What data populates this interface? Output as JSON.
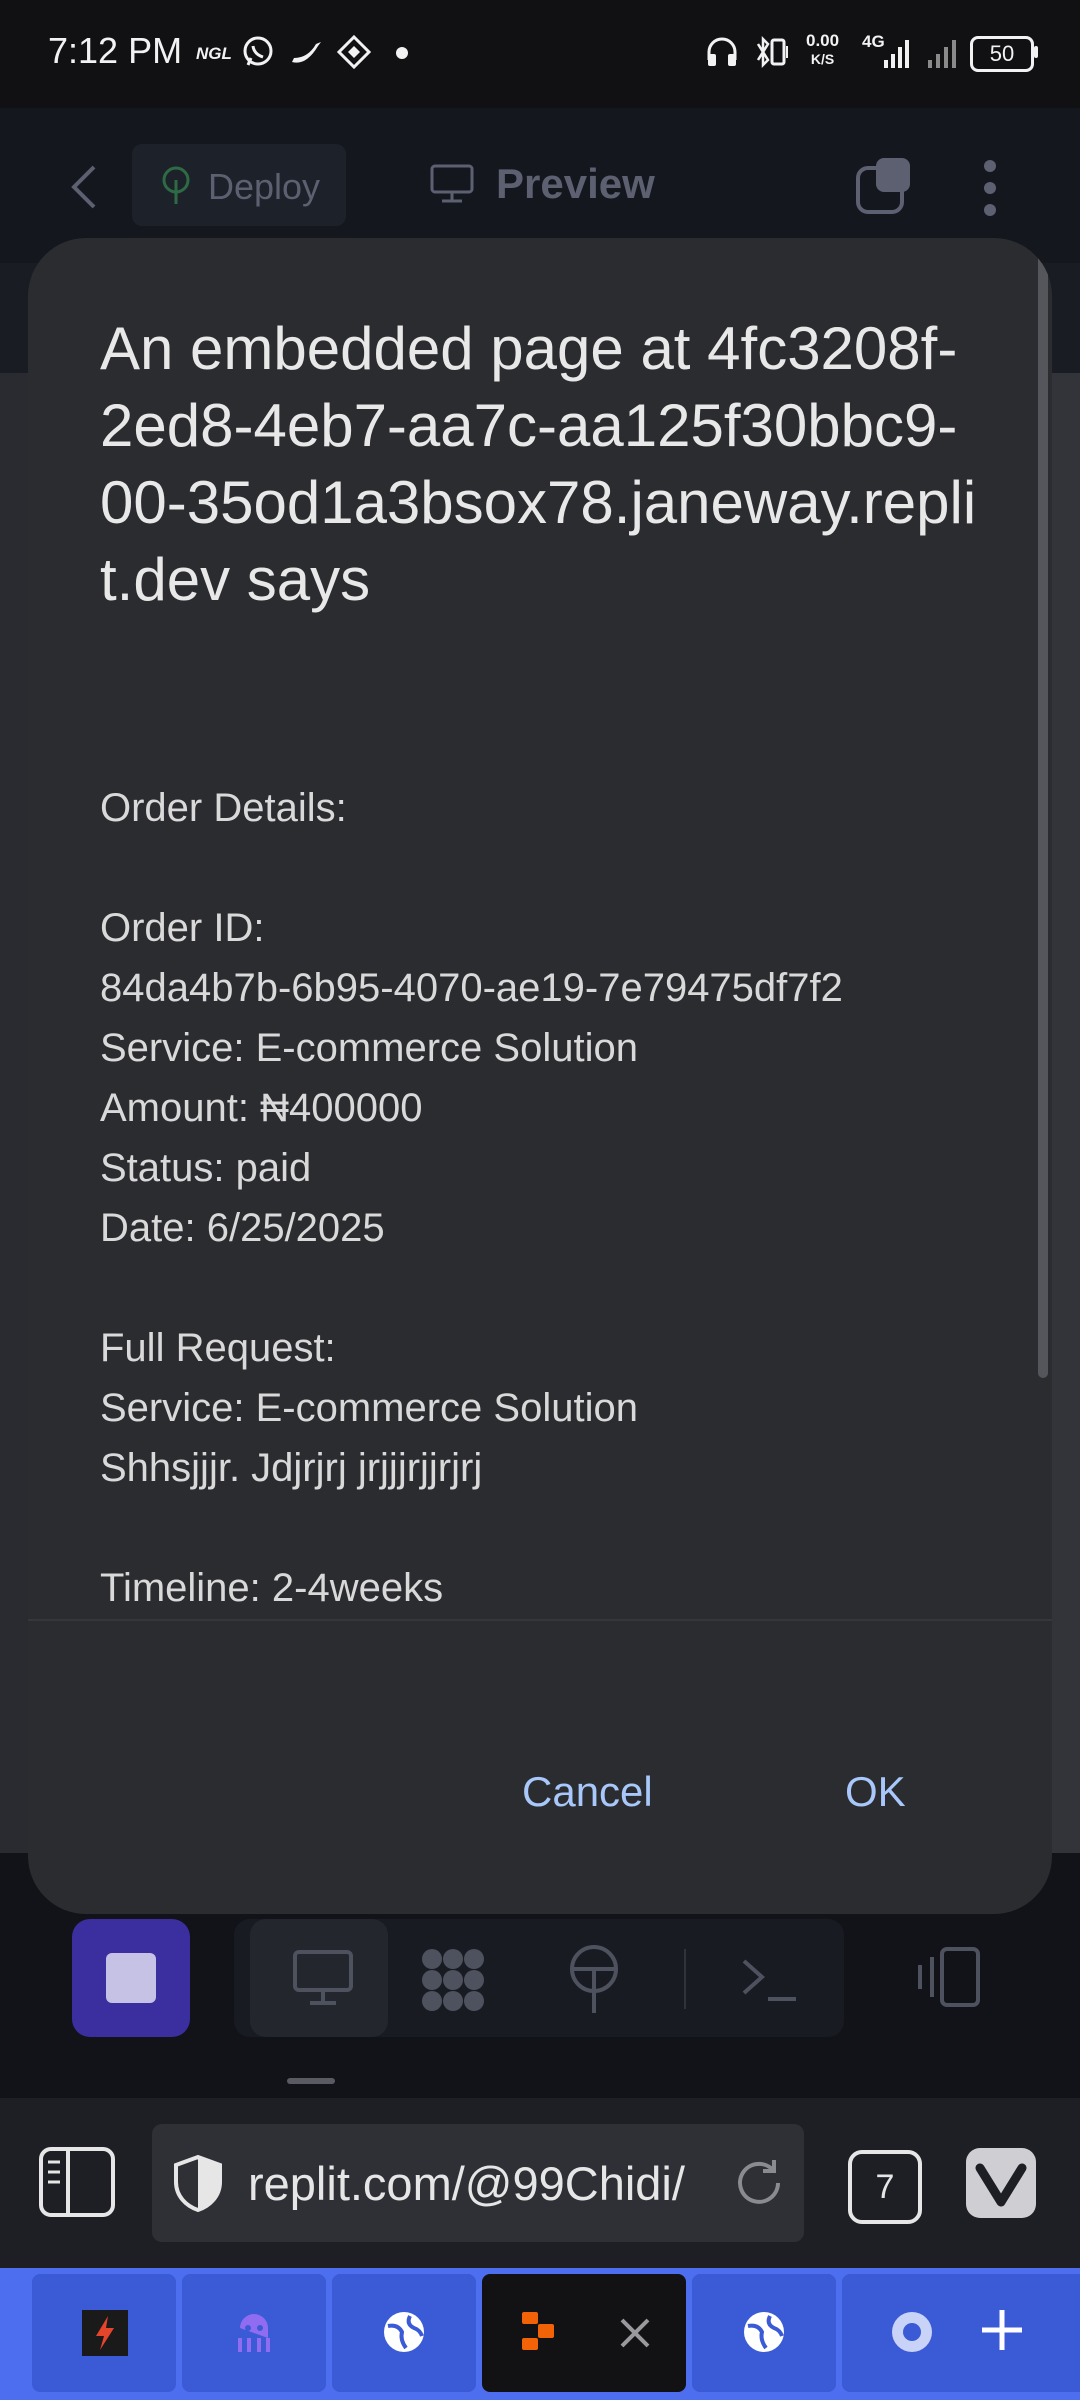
{
  "status_bar": {
    "time": "7:12 PM",
    "ngl_label": "NGL",
    "net_speed_value": "0.00",
    "net_speed_unit": "K/S",
    "network_type": "4G",
    "battery": "50"
  },
  "app_header": {
    "deploy_label": "Deploy",
    "preview_label": "Preview"
  },
  "dialog": {
    "title": "An embedded page at 4fc3208f-2ed8-4eb7-aa7c-aa125f30bbc9-00-35od1a3bsox78.janeway.replit.dev says",
    "lines": {
      "order_details": "Order Details:",
      "order_id_label": "Order ID:",
      "order_id": "84da4b7b-6b95-4070-ae19-7e79475df7f2",
      "service": "Service: E-commerce Solution",
      "amount": "Amount: ₦400000",
      "status": "Status: paid",
      "date": "Date: 6/25/2025",
      "full_request": "Full Request:",
      "request_service": "Service: E-commerce Solution",
      "request_text": "Shhsjjjr. Jdjrjrj jrjjjrjjrjrj",
      "timeline": "Timeline: 2-4weeks"
    },
    "cancel_label": "Cancel",
    "ok_label": "OK"
  },
  "browser": {
    "url": "replit.com/@99Chidi/",
    "tab_count": "7"
  },
  "colors": {
    "dialog_bg": "#2b2c30",
    "button_text": "#a8c7fa",
    "tabstrip": "#4e6ef0",
    "active_toolbar_btn": "#3b2fa0"
  }
}
